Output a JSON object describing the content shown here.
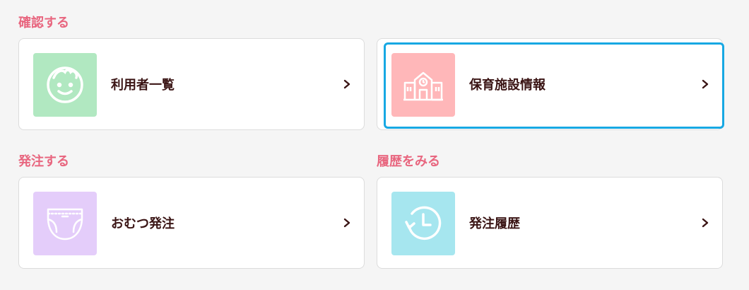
{
  "sections": {
    "confirm": "確認する",
    "order": "発注する",
    "history": "履歴をみる"
  },
  "cards": {
    "users": {
      "label": "利用者一覧",
      "icon": "smiley-face-icon",
      "color": "#b1e8c1"
    },
    "facility": {
      "label": "保育施設情報",
      "icon": "school-building-icon",
      "color": "#ffb7b9"
    },
    "diaper": {
      "label": "おむつ発注",
      "icon": "diaper-icon",
      "color": "#e4cdfa"
    },
    "orderHistory": {
      "label": "発注履歴",
      "icon": "history-clock-icon",
      "color": "#a6e6ef"
    }
  },
  "colors": {
    "accent": "#e8667f",
    "focus": "#17a8e3",
    "text": "#3a1414"
  }
}
